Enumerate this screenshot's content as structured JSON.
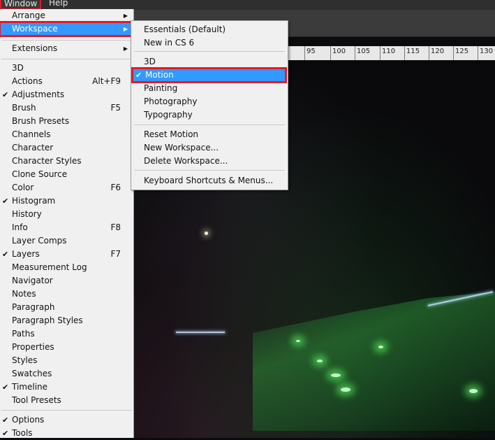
{
  "menubar": {
    "window_label": "Window",
    "help_label": "Help"
  },
  "ruler": {
    "ticks": [
      "95",
      "100",
      "105",
      "110",
      "115",
      "120",
      "125",
      "130"
    ]
  },
  "window_menu": {
    "arrange": "Arrange",
    "workspace": "Workspace",
    "extensions": "Extensions",
    "items": [
      {
        "label": "3D",
        "shortcut": "",
        "checked": false
      },
      {
        "label": "Actions",
        "shortcut": "Alt+F9",
        "checked": false
      },
      {
        "label": "Adjustments",
        "shortcut": "",
        "checked": true
      },
      {
        "label": "Brush",
        "shortcut": "F5",
        "checked": false
      },
      {
        "label": "Brush Presets",
        "shortcut": "",
        "checked": false
      },
      {
        "label": "Channels",
        "shortcut": "",
        "checked": false
      },
      {
        "label": "Character",
        "shortcut": "",
        "checked": false
      },
      {
        "label": "Character Styles",
        "shortcut": "",
        "checked": false
      },
      {
        "label": "Clone Source",
        "shortcut": "",
        "checked": false
      },
      {
        "label": "Color",
        "shortcut": "F6",
        "checked": false
      },
      {
        "label": "Histogram",
        "shortcut": "",
        "checked": true
      },
      {
        "label": "History",
        "shortcut": "",
        "checked": false
      },
      {
        "label": "Info",
        "shortcut": "F8",
        "checked": false
      },
      {
        "label": "Layer Comps",
        "shortcut": "",
        "checked": false
      },
      {
        "label": "Layers",
        "shortcut": "F7",
        "checked": true
      },
      {
        "label": "Measurement Log",
        "shortcut": "",
        "checked": false
      },
      {
        "label": "Navigator",
        "shortcut": "",
        "checked": false
      },
      {
        "label": "Notes",
        "shortcut": "",
        "checked": false
      },
      {
        "label": "Paragraph",
        "shortcut": "",
        "checked": false
      },
      {
        "label": "Paragraph Styles",
        "shortcut": "",
        "checked": false
      },
      {
        "label": "Paths",
        "shortcut": "",
        "checked": false
      },
      {
        "label": "Properties",
        "shortcut": "",
        "checked": false
      },
      {
        "label": "Styles",
        "shortcut": "",
        "checked": false
      },
      {
        "label": "Swatches",
        "shortcut": "",
        "checked": false
      },
      {
        "label": "Timeline",
        "shortcut": "",
        "checked": true
      },
      {
        "label": "Tool Presets",
        "shortcut": "",
        "checked": false
      }
    ],
    "options": {
      "label": "Options",
      "checked": true
    },
    "tools": {
      "label": "Tools",
      "checked": true
    }
  },
  "workspace_menu": {
    "essentials": "Essentials (Default)",
    "new_in_cs6": "New in CS 6",
    "three_d": "3D",
    "motion": "Motion",
    "painting": "Painting",
    "photography": "Photography",
    "typography": "Typography",
    "reset_motion": "Reset Motion",
    "new_workspace": "New Workspace...",
    "delete_workspace": "Delete Workspace...",
    "keyboard_shortcuts": "Keyboard Shortcuts & Menus..."
  },
  "symbols": {
    "check": "✔",
    "arrow": "▶"
  },
  "colors": {
    "highlight": "#3399ff",
    "annotation": "#e01b2a"
  }
}
